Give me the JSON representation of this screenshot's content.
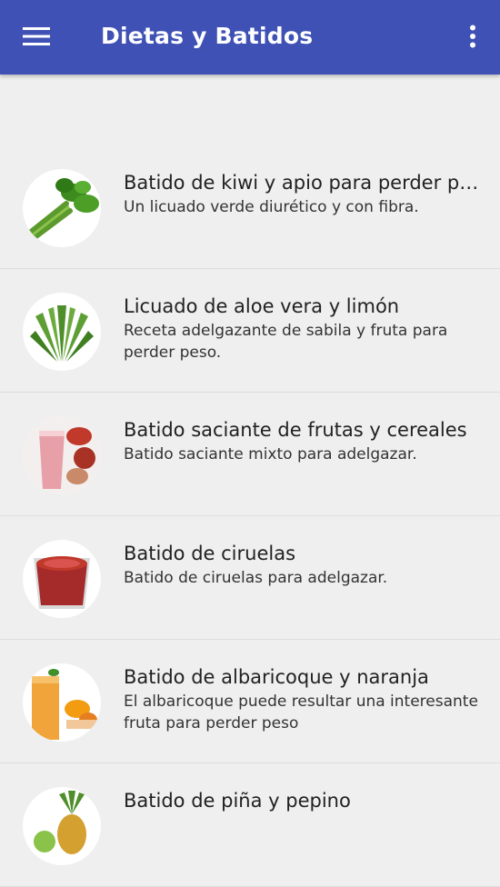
{
  "appbar": {
    "title": "Dietas y Batidos",
    "menu_icon": "hamburger-menu-icon",
    "more_icon": "more-vert-icon",
    "color": "#3f51b5"
  },
  "items": [
    {
      "title": "Batido de kiwi y apio para perder peso",
      "subtitle": "Un licuado verde diurético y con fibra.",
      "image": "celery-image"
    },
    {
      "title": "Licuado de aloe vera y limón",
      "subtitle": "Receta adelgazante de sabila y fruta para perder peso.",
      "image": "aloe-vera-image"
    },
    {
      "title": "Batido saciante de frutas y cereales",
      "subtitle": "Batido saciante mixto para adelgazar.",
      "image": "fruit-smoothie-image"
    },
    {
      "title": "Batido de ciruelas",
      "subtitle": "Batido de ciruelas para adelgazar.",
      "image": "plum-smoothie-image"
    },
    {
      "title": "Batido de albaricoque y naranja",
      "subtitle": "El albaricoque puede resultar una interesante fruta para perder peso",
      "image": "apricot-smoothie-image"
    },
    {
      "title": "Batido de piña y pepino",
      "subtitle": "",
      "image": "pineapple-image"
    }
  ]
}
